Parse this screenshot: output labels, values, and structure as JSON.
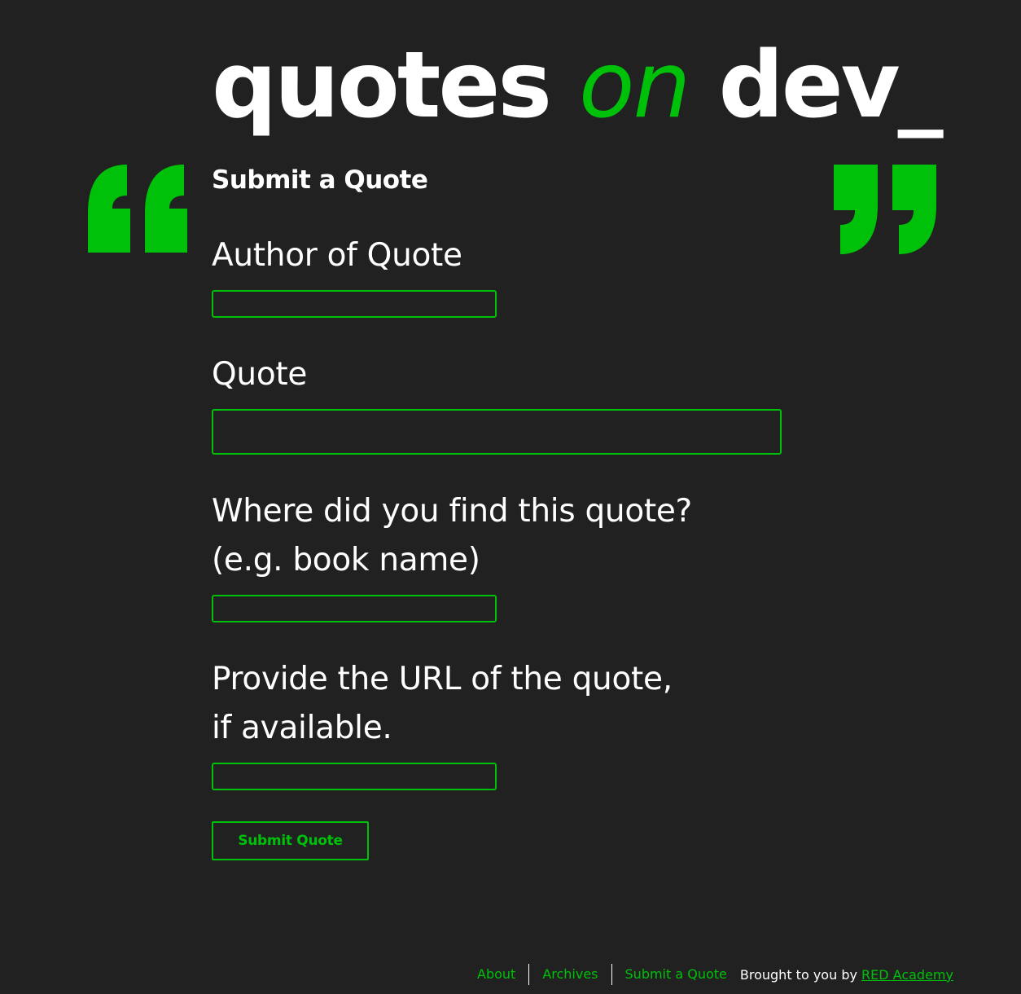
{
  "site": {
    "logo_part1": "quotes ",
    "logo_part2": "on",
    "logo_part3": " dev_"
  },
  "form": {
    "title": "Submit a Quote",
    "fields": [
      {
        "label": "Author of Quote",
        "value": ""
      },
      {
        "label": "Quote",
        "value": ""
      },
      {
        "label": "Where did you find this quote? (e.g. book name)",
        "value": ""
      },
      {
        "label": "Provide the URL of the quote, if available.",
        "value": ""
      }
    ],
    "submit_label": "Submit Quote"
  },
  "footer": {
    "nav": [
      {
        "label": "About"
      },
      {
        "label": "Archives"
      },
      {
        "label": "Submit a Quote"
      }
    ],
    "credit_prefix": "Brought to you by ",
    "credit_link": "RED Academy"
  },
  "colors": {
    "background": "#212121",
    "accent": "#00c10a",
    "text": "#ffffff"
  },
  "icons": {
    "left_quote": "open-quote-icon",
    "right_quote": "close-quote-icon"
  }
}
